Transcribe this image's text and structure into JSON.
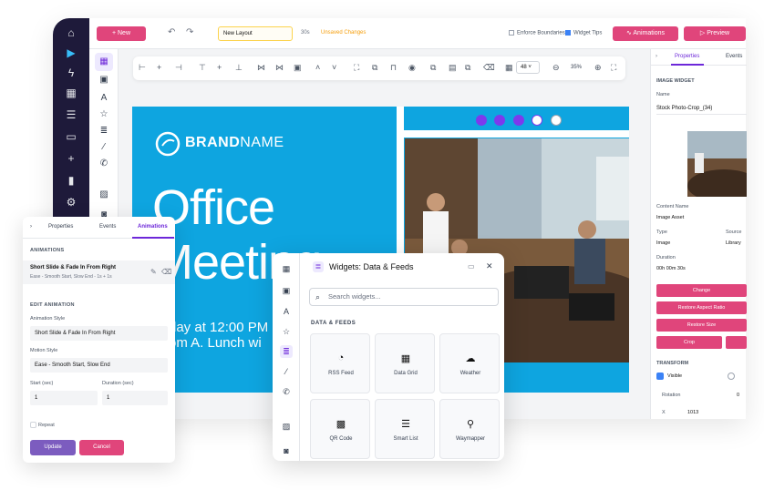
{
  "topbar": {
    "new_label": "+ New",
    "layout_name": "New Layout",
    "zoom": "30s",
    "unsaved": "Unsaved Changes",
    "enforce_boundaries": "Enforce Boundaries",
    "widget_tips": "Widget Tips",
    "animations_label": "Animations",
    "preview_label": "Preview"
  },
  "toolbar": {
    "font_size": "48",
    "zoom": "35%"
  },
  "canvas": {
    "brand_bold": "BRAND",
    "brand_rest": "NAME",
    "headline_line1": "Office",
    "headline_line2": "Meeting",
    "sub_line1": "day at 12:00 PM",
    "sub_line2": "om A. Lunch wi"
  },
  "right_panel": {
    "tab_properties": "Properties",
    "tab_events": "Events",
    "section": "IMAGE WIDGET",
    "name_label": "Name",
    "name_value": "Stock Photo-Crop_(34)",
    "content_name_label": "Content Name",
    "content_name_value": "Image Asset",
    "type_label": "Type",
    "type_value": "Image",
    "source_label": "Source",
    "source_value": "Library",
    "duration_label": "Duration",
    "duration_value": "00h 00m 30s",
    "change_btn": "Change",
    "restore_aspect_btn": "Restore Aspect Ratio",
    "restore_size_btn": "Restore Size",
    "crop_btn": "Crop",
    "transform_label": "TRANSFORM",
    "visible_label": "Visible",
    "rotation_label": "Rotation",
    "rotation_value": "0",
    "x_label": "X",
    "x_value": "1013"
  },
  "anim_panel": {
    "tab_properties": "Properties",
    "tab_events": "Events",
    "tab_animations": "Animations",
    "section_animations": "ANIMATIONS",
    "item_title": "Short Slide & Fade In From Right",
    "item_sub": "Ease - Smooth Start, Slow End - 1s + 1s",
    "section_edit": "EDIT ANIMATION",
    "style_label": "Animation Style",
    "style_value": "Short Slide & Fade In From Right",
    "motion_label": "Motion Style",
    "motion_value": "Ease - Smooth Start, Slow End",
    "start_label": "Start (sec)",
    "start_value": "1",
    "duration_label": "Duration (sec)",
    "duration_value": "1",
    "repeat_label": "Repeat",
    "update_btn": "Update",
    "cancel_btn": "Cancel"
  },
  "widgets_panel": {
    "title": "Widgets: Data & Feeds",
    "search_placeholder": "Search widgets...",
    "category": "DATA & FEEDS",
    "items": [
      {
        "label": "RSS Feed",
        "icon": "rss-icon"
      },
      {
        "label": "Data Grid",
        "icon": "grid-icon"
      },
      {
        "label": "Weather",
        "icon": "cloud-icon"
      },
      {
        "label": "QR Code",
        "icon": "qr-icon"
      },
      {
        "label": "Smart List",
        "icon": "list-icon"
      },
      {
        "label": "Waymapper",
        "icon": "map-pin-icon"
      }
    ]
  },
  "colors": {
    "accent_pink": "#e0457b",
    "accent_purple": "#6d28d9",
    "nav_dark": "#1e1a3a",
    "canvas_blue": "#0ea5e0"
  }
}
